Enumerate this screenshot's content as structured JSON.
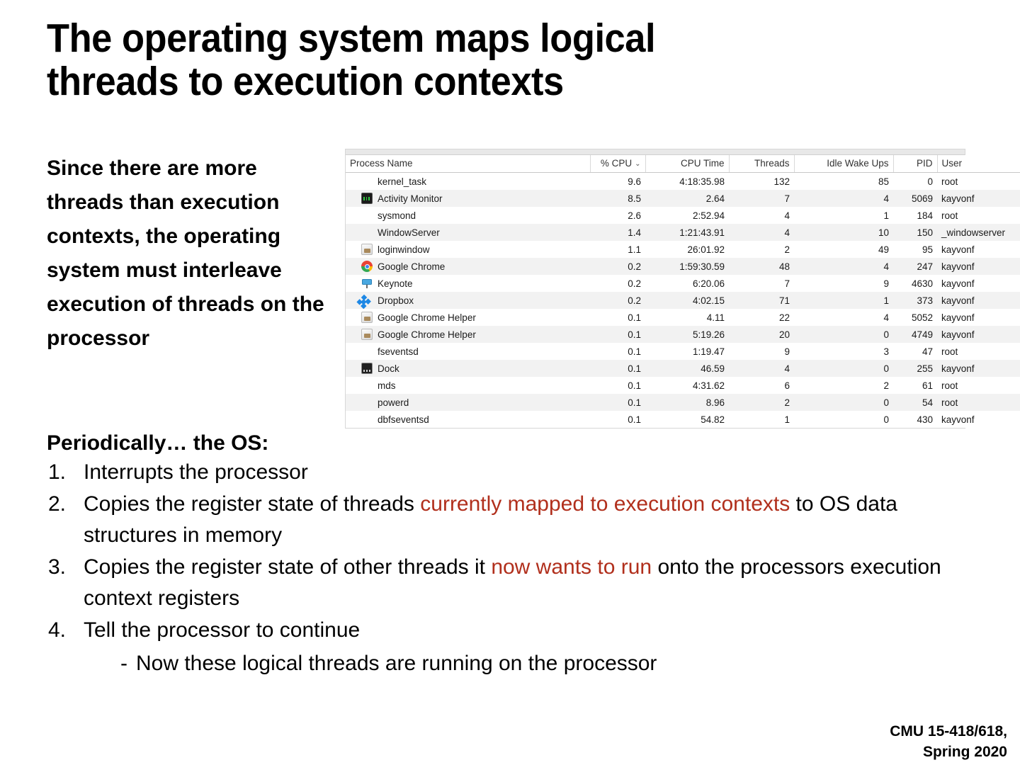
{
  "slide": {
    "title_line1": "The operating system maps logical",
    "title_line2": "threads to execution contexts",
    "intro_paragraph": "Since there are more threads than execution contexts, the operating system must interleave execution of threads on the processor",
    "periodically_heading": "Periodically… the OS:",
    "footer_line1": "CMU 15-418/618,",
    "footer_line2": "Spring 2020"
  },
  "steps": [
    {
      "num": "1.",
      "parts": [
        {
          "text": "Interrupts the processor",
          "highlight": false
        }
      ]
    },
    {
      "num": "2.",
      "parts": [
        {
          "text": "Copies the register state of threads ",
          "highlight": false
        },
        {
          "text": "currently mapped to execution contexts",
          "highlight": true
        },
        {
          "text": " to OS data structures in memory",
          "highlight": false
        }
      ]
    },
    {
      "num": "3.",
      "parts": [
        {
          "text": "Copies the register state of other threads it ",
          "highlight": false
        },
        {
          "text": "now wants to run",
          "highlight": true
        },
        {
          "text": " onto the processors execution context registers",
          "highlight": false
        }
      ]
    },
    {
      "num": "4.",
      "parts": [
        {
          "text": "Tell the processor to continue",
          "highlight": false
        }
      ]
    }
  ],
  "substep": {
    "dash": "-",
    "text": "Now these logical threads are running on the processor"
  },
  "activity_monitor": {
    "sort_indicator": "⌄",
    "columns": [
      {
        "key": "process_name",
        "label": "Process Name",
        "align": "left"
      },
      {
        "key": "cpu_pct",
        "label": "% CPU",
        "align": "right",
        "sorted": true
      },
      {
        "key": "cpu_time",
        "label": "CPU Time",
        "align": "right"
      },
      {
        "key": "threads",
        "label": "Threads",
        "align": "right"
      },
      {
        "key": "idle_wake_ups",
        "label": "Idle Wake Ups",
        "align": "right"
      },
      {
        "key": "pid",
        "label": "PID",
        "align": "right"
      },
      {
        "key": "user",
        "label": "User",
        "align": "left"
      }
    ],
    "rows": [
      {
        "icon": "none",
        "process_name": "kernel_task",
        "cpu_pct": "9.6",
        "cpu_time": "4:18:35.98",
        "threads": "132",
        "idle_wake_ups": "85",
        "pid": "0",
        "user": "root"
      },
      {
        "icon": "activity",
        "process_name": "Activity Monitor",
        "cpu_pct": "8.5",
        "cpu_time": "2.64",
        "threads": "7",
        "idle_wake_ups": "4",
        "pid": "5069",
        "user": "kayvonf"
      },
      {
        "icon": "none",
        "process_name": "sysmond",
        "cpu_pct": "2.6",
        "cpu_time": "2:52.94",
        "threads": "4",
        "idle_wake_ups": "1",
        "pid": "184",
        "user": "root"
      },
      {
        "icon": "none",
        "process_name": "WindowServer",
        "cpu_pct": "1.4",
        "cpu_time": "1:21:43.91",
        "threads": "4",
        "idle_wake_ups": "10",
        "pid": "150",
        "user": "_windowserver"
      },
      {
        "icon": "loginwindow",
        "process_name": "loginwindow",
        "cpu_pct": "1.1",
        "cpu_time": "26:01.92",
        "threads": "2",
        "idle_wake_ups": "49",
        "pid": "95",
        "user": "kayvonf"
      },
      {
        "icon": "chrome",
        "process_name": "Google Chrome",
        "cpu_pct": "0.2",
        "cpu_time": "1:59:30.59",
        "threads": "48",
        "idle_wake_ups": "4",
        "pid": "247",
        "user": "kayvonf"
      },
      {
        "icon": "keynote",
        "process_name": "Keynote",
        "cpu_pct": "0.2",
        "cpu_time": "6:20.06",
        "threads": "7",
        "idle_wake_ups": "9",
        "pid": "4630",
        "user": "kayvonf"
      },
      {
        "icon": "dropbox",
        "process_name": "Dropbox",
        "cpu_pct": "0.2",
        "cpu_time": "4:02.15",
        "threads": "71",
        "idle_wake_ups": "1",
        "pid": "373",
        "user": "kayvonf"
      },
      {
        "icon": "loginwindow",
        "process_name": "Google Chrome Helper",
        "cpu_pct": "0.1",
        "cpu_time": "4.11",
        "threads": "22",
        "idle_wake_ups": "4",
        "pid": "5052",
        "user": "kayvonf"
      },
      {
        "icon": "loginwindow",
        "process_name": "Google Chrome Helper",
        "cpu_pct": "0.1",
        "cpu_time": "5:19.26",
        "threads": "20",
        "idle_wake_ups": "0",
        "pid": "4749",
        "user": "kayvonf"
      },
      {
        "icon": "none",
        "process_name": "fseventsd",
        "cpu_pct": "0.1",
        "cpu_time": "1:19.47",
        "threads": "9",
        "idle_wake_ups": "3",
        "pid": "47",
        "user": "root"
      },
      {
        "icon": "dock",
        "process_name": "Dock",
        "cpu_pct": "0.1",
        "cpu_time": "46.59",
        "threads": "4",
        "idle_wake_ups": "0",
        "pid": "255",
        "user": "kayvonf"
      },
      {
        "icon": "none",
        "process_name": "mds",
        "cpu_pct": "0.1",
        "cpu_time": "4:31.62",
        "threads": "6",
        "idle_wake_ups": "2",
        "pid": "61",
        "user": "root"
      },
      {
        "icon": "none",
        "process_name": "powerd",
        "cpu_pct": "0.1",
        "cpu_time": "8.96",
        "threads": "2",
        "idle_wake_ups": "0",
        "pid": "54",
        "user": "root"
      },
      {
        "icon": "none",
        "process_name": "dbfseventsd",
        "cpu_pct": "0.1",
        "cpu_time": "54.82",
        "threads": "1",
        "idle_wake_ups": "0",
        "pid": "430",
        "user": "kayvonf"
      }
    ]
  },
  "colors": {
    "highlight_red": "#B12F1C",
    "row_stripe": "#F2F2F2",
    "text": "#000000"
  }
}
